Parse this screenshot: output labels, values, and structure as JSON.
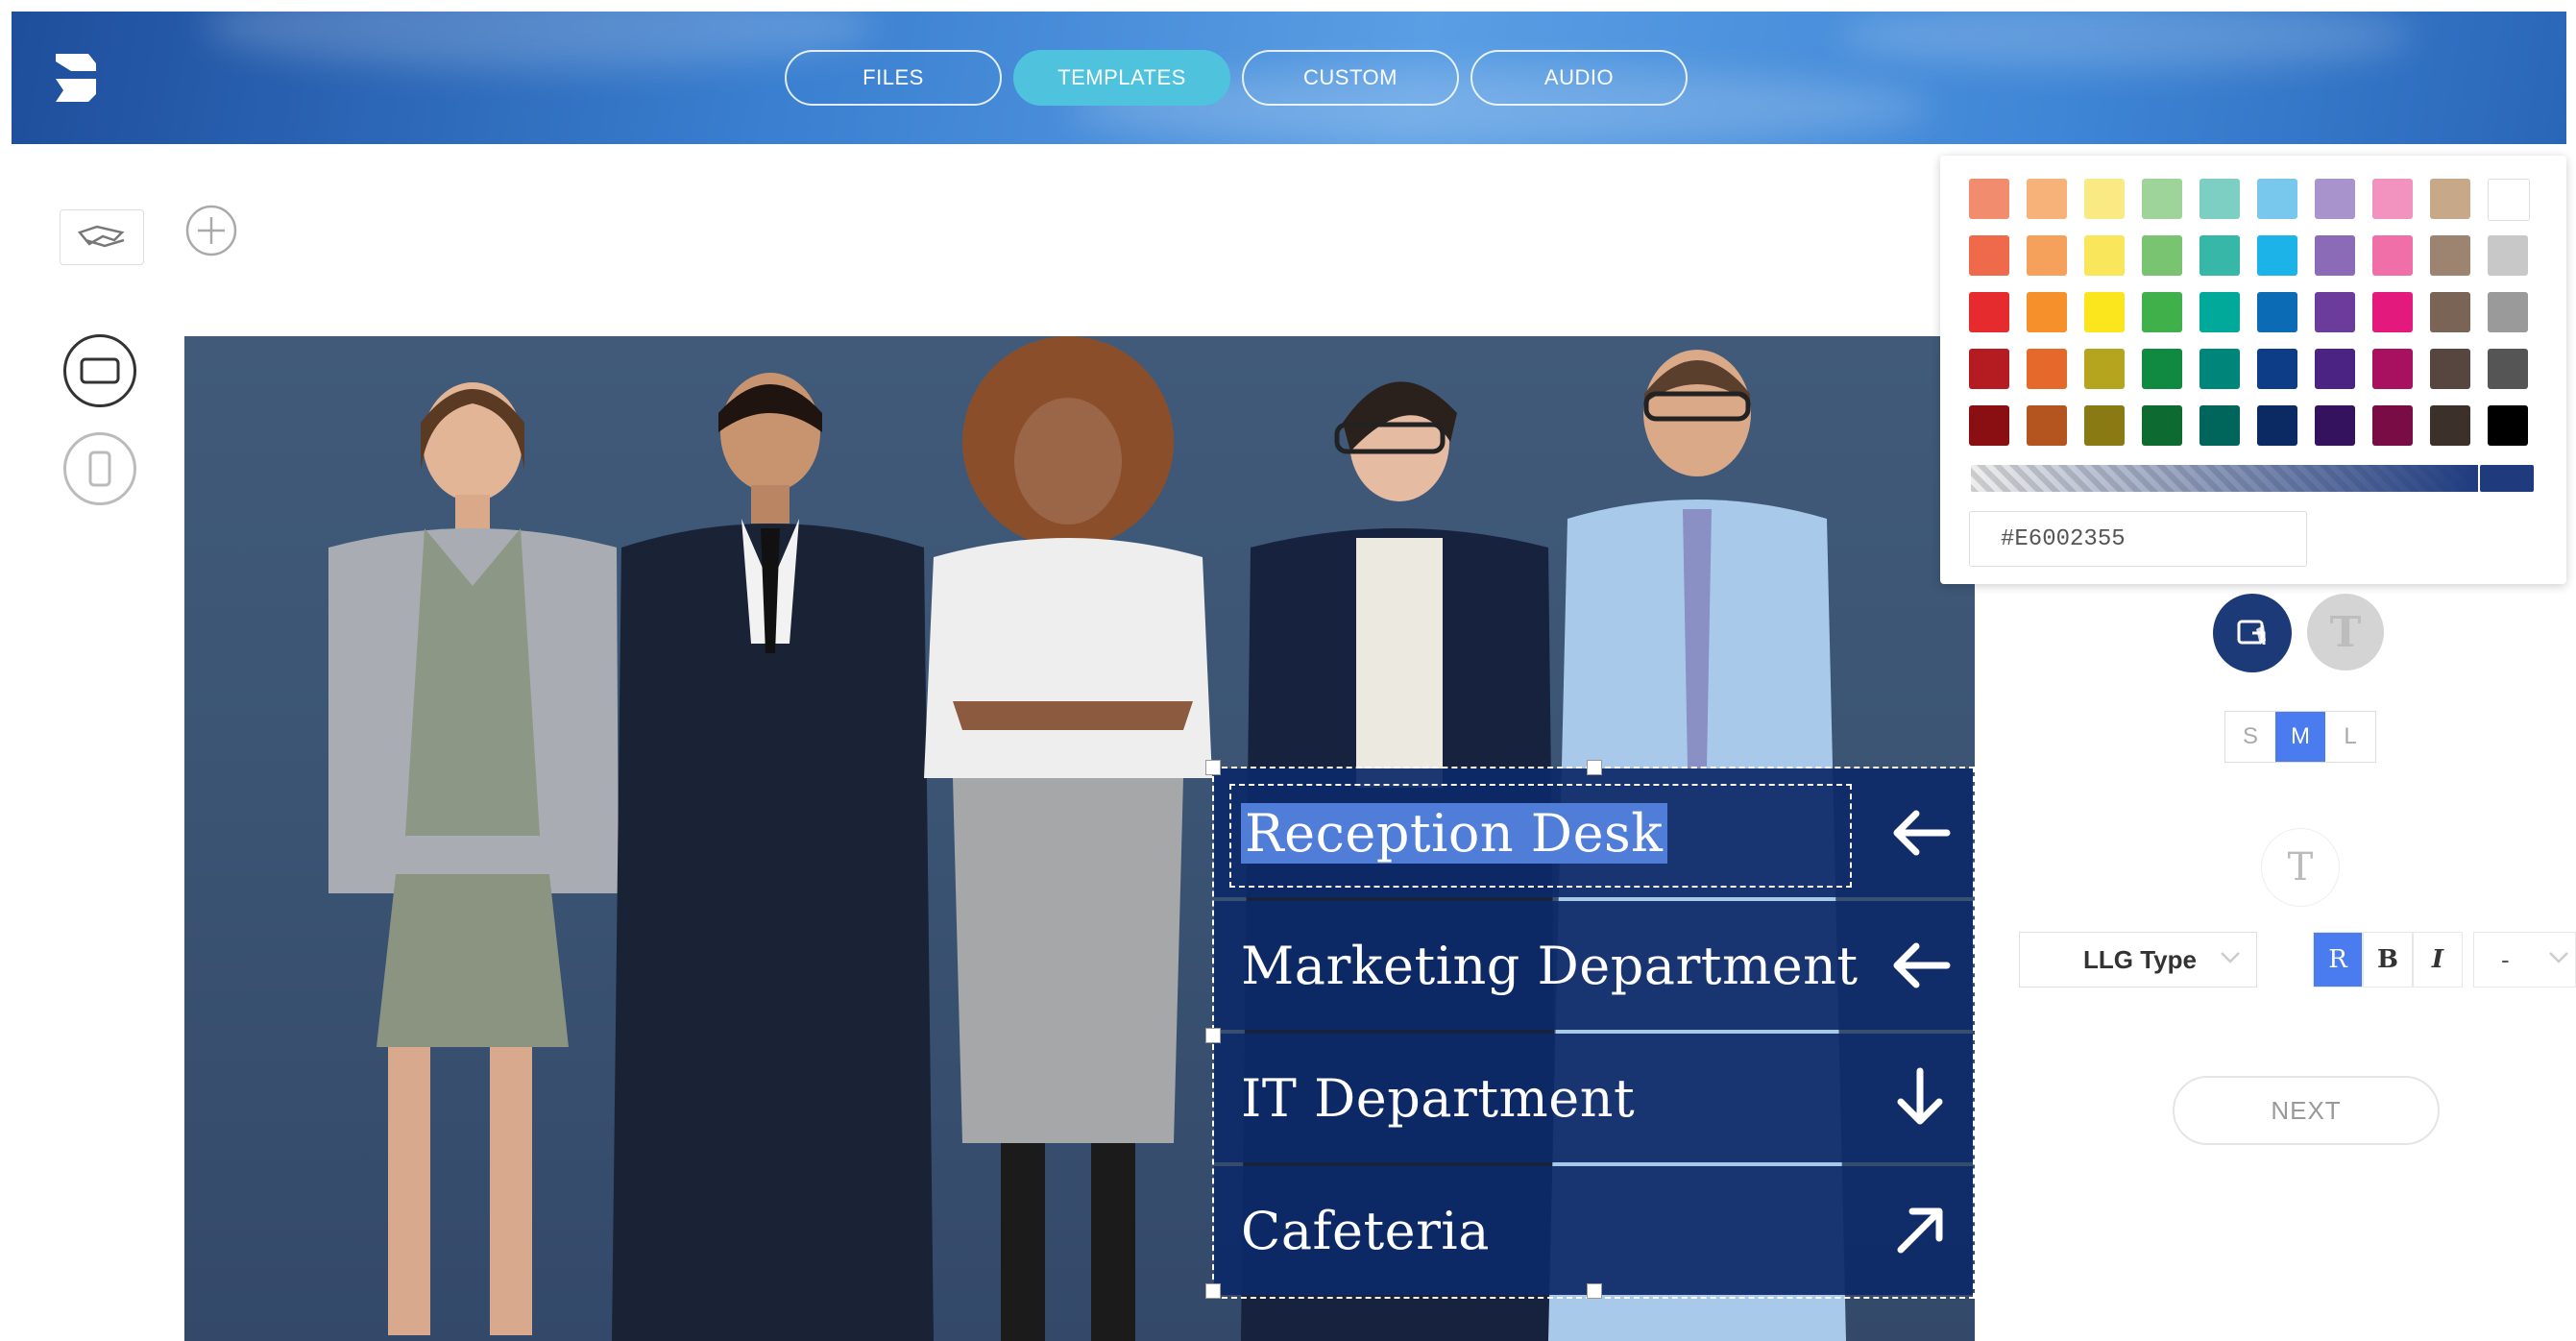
{
  "nav": {
    "tabs": [
      {
        "label": "FILES",
        "active": false
      },
      {
        "label": "TEMPLATES",
        "active": true
      },
      {
        "label": "CUSTOM",
        "active": false
      },
      {
        "label": "AUDIO",
        "active": false
      }
    ],
    "active_color": "#4fc3de"
  },
  "left_tools": {
    "icons": [
      "hand-sign-icon",
      "add-icon",
      "landscape-ratio-icon",
      "portrait-ratio-icon"
    ]
  },
  "sign": {
    "rows": [
      {
        "text": "Reception Desk",
        "arrow": "arrow-left-icon",
        "selected": true
      },
      {
        "text": "Marketing Department",
        "arrow": "arrow-left-icon"
      },
      {
        "text": "IT Department",
        "arrow": "arrow-down-icon"
      },
      {
        "text": "Cafeteria",
        "arrow": "arrow-up-right-icon"
      }
    ],
    "background_color": "#0d2a68",
    "selection_highlight": "#4f7dd8"
  },
  "color_picker": {
    "hex_value": "#E6002355",
    "swatches": [
      [
        "#f28c6e",
        "#f7b27a",
        "#f9ea84",
        "#9ed49a",
        "#7dcfc3",
        "#78c7ec",
        "#a893cd",
        "#f292bf",
        "#c7a98a",
        "#ffffff"
      ],
      [
        "#ef6a4a",
        "#f6a15b",
        "#f9e65b",
        "#78c471",
        "#36b7a8",
        "#1cb4e8",
        "#8b6ab8",
        "#f06fa8",
        "#9c8470",
        "#c8c8c8"
      ],
      [
        "#e52b2e",
        "#f5902a",
        "#fbe51c",
        "#3fb04a",
        "#00a99a",
        "#0c6bb5",
        "#6b3c9b",
        "#e3197d",
        "#7a6455",
        "#9a9a9a"
      ],
      [
        "#b51c22",
        "#e5692a",
        "#b5a51e",
        "#0f8a40",
        "#00857a",
        "#0c3d86",
        "#4b2383",
        "#a8115f",
        "#574640",
        "#555555"
      ],
      [
        "#8a0f13",
        "#b4541e",
        "#8a7a14",
        "#0d6a31",
        "#00665c",
        "#0b2a63",
        "#35125e",
        "#7a0c45",
        "#3c302b",
        "#000000"
      ]
    ],
    "gradient_end": "#1f3b7e"
  },
  "right_panel": {
    "size_options": [
      {
        "label": "S",
        "active": false
      },
      {
        "label": "M",
        "active": true
      },
      {
        "label": "L",
        "active": false
      }
    ],
    "font_name": "LLG Type",
    "style_buttons": [
      {
        "label": "R",
        "active": true
      },
      {
        "label": "B",
        "active": false
      },
      {
        "label": "I",
        "active": false
      }
    ],
    "size_value": "-",
    "next_label": "NEXT"
  }
}
